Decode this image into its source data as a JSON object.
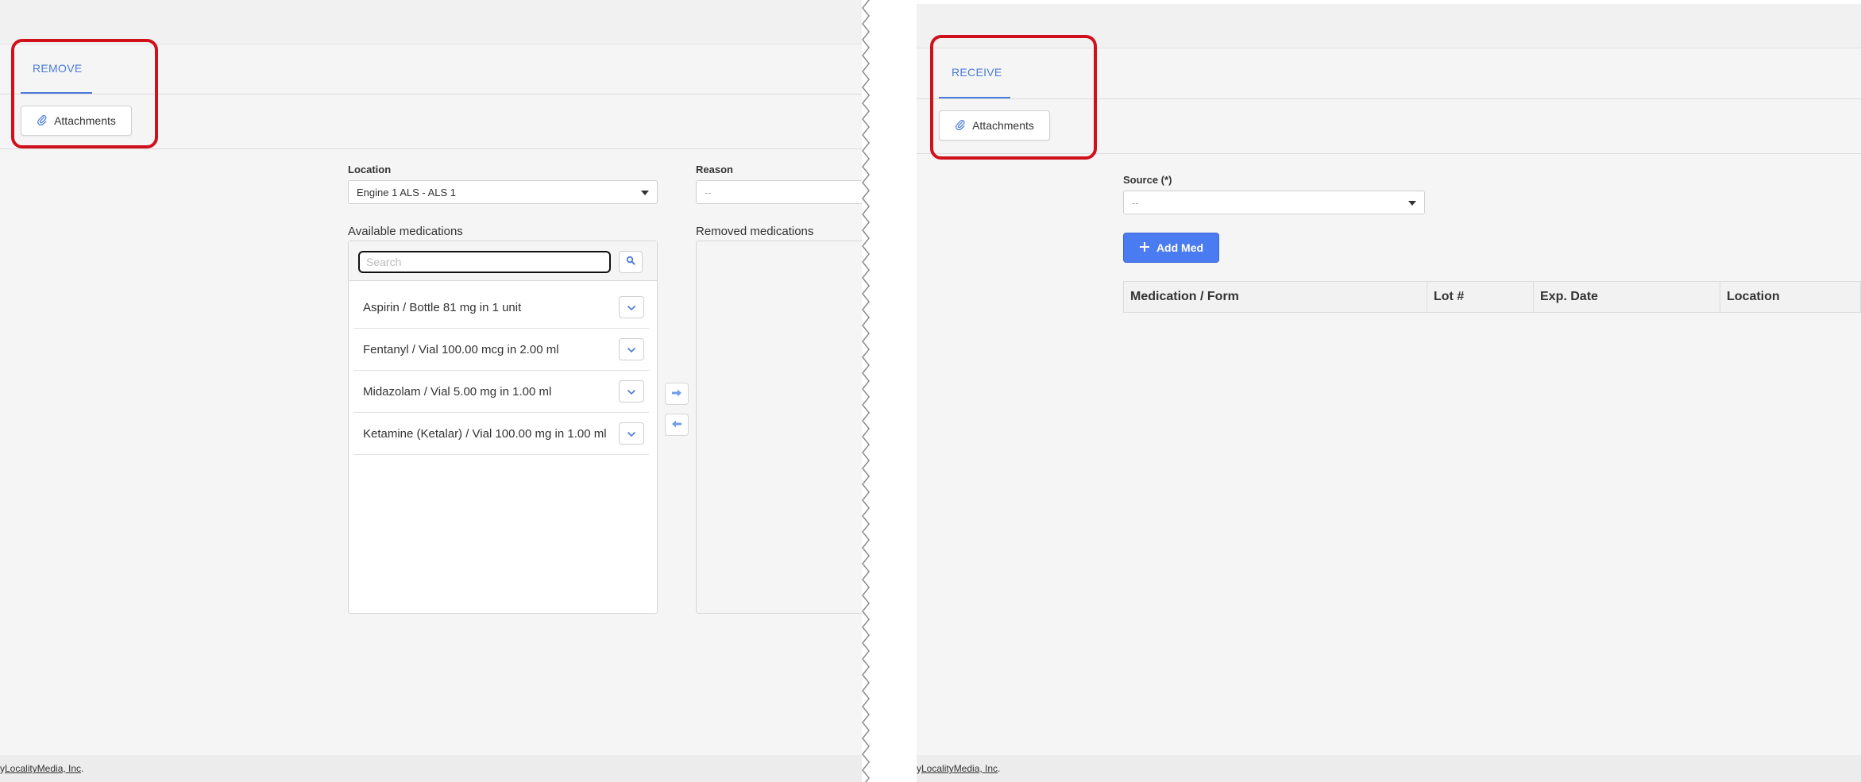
{
  "remove_screen": {
    "tab_label": "REMOVE",
    "attachments_label": "Attachments",
    "location_label": "Location",
    "location_value": "Engine 1 ALS - ALS 1",
    "reason_label": "Reason",
    "reason_value": "--",
    "available_label": "Available medications",
    "search_placeholder": "Search",
    "removed_label": "Removed medications",
    "medications": [
      "Aspirin / Bottle 81 mg in 1 unit",
      "Fentanyl / Vial 100.00 mcg in 2.00 ml",
      "Midazolam / Vial 5.00 mg in 1.00 ml",
      "Ketamine (Ketalar) / Vial 100.00 mg in 1.00 ml"
    ],
    "footer_prefix": "y",
    "footer_link": "LocalityMedia, Inc",
    "footer_suffix": "."
  },
  "receive_screen": {
    "tab_label": "RECEIVE",
    "attachments_label": "Attachments",
    "source_label": "Source (*)",
    "source_value": "--",
    "add_med_label": "Add Med",
    "table_headers": [
      "Medication / Form",
      "Lot #",
      "Exp. Date",
      "Location"
    ],
    "footer_prefix": "y",
    "footer_link": "LocalityMedia, Inc",
    "footer_suffix": "."
  },
  "colors": {
    "accent": "#4a7bd8",
    "primary_button": "#4a7bf0",
    "highlight_box": "#d0101a",
    "background": "#f5f5f5"
  },
  "icons": {
    "attachments": "paperclip-icon",
    "search": "search-icon",
    "expand": "chevron-down-icon",
    "move_right": "arrow-right-icon",
    "move_left": "arrow-left-icon",
    "add": "plus-icon",
    "dropdown": "caret-down-icon"
  }
}
